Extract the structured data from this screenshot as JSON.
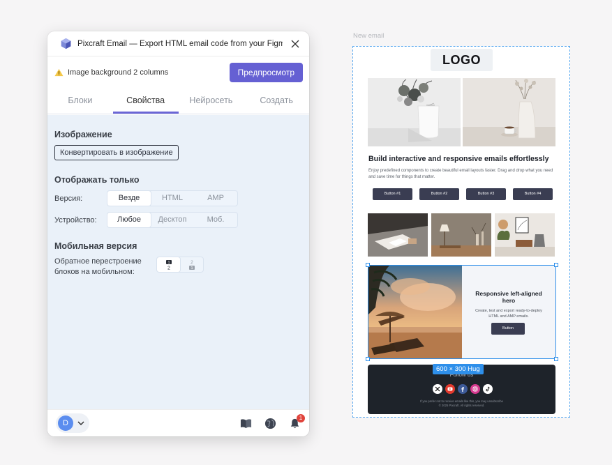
{
  "panel": {
    "title": "Pixcraft Email — Export HTML email code from your Figma...",
    "status_text": "Image background 2 columns",
    "preview_button": "Предпросмотр",
    "tabs": [
      "Блоки",
      "Свойства",
      "Нейросеть",
      "Создать"
    ],
    "active_tab": "Свойства",
    "image_section": {
      "title": "Изображение",
      "convert_button": "Конвертировать в изображение"
    },
    "display_section": {
      "title": "Отображать только",
      "version_label": "Версия:",
      "version_options": [
        "Везде",
        "HTML",
        "AMP"
      ],
      "version_selected": "Везде",
      "device_label": "Устройство:",
      "device_options": [
        "Любое",
        "Десктоп",
        "Моб."
      ],
      "device_selected": "Любое"
    },
    "mobile_section": {
      "title": "Мобильная версия",
      "reverse_label": "Обратное перестроение блоков на мобильном:",
      "reverse_options": [
        "1 2",
        "2 1"
      ]
    },
    "footer": {
      "avatar_initial": "D",
      "notification_count": "1"
    }
  },
  "canvas": {
    "frame_label": "New email",
    "logo_text": "LOGO",
    "headline": "Build interactive and responsive emails effortlessly",
    "body_text": "Enjoy predefined components to create beautiful email layouts faster. Drag and drop what you need and save time for things that matter.",
    "buttons": [
      "Button #1",
      "Button #2",
      "Button #3",
      "Button #4"
    ],
    "hero_title": "Responsive left-aligned hero",
    "hero_text": "Create, test and export ready-to-deploy HTML and AMP emails.",
    "hero_button": "Button",
    "size_tag": "600 × 300 Hug",
    "follow_us": "Follow us",
    "footer_small": "If you prefer not to receive emails like this, you may unsubscribe",
    "footer_copyright": "© 2025 Pixcraft. All rights reserved."
  },
  "colors": {
    "accent": "#6560d3",
    "selection": "#2e8fea",
    "content_bg": "#eaf1f9",
    "email_footer": "#1e232a",
    "button_dark": "#3a3d52"
  }
}
